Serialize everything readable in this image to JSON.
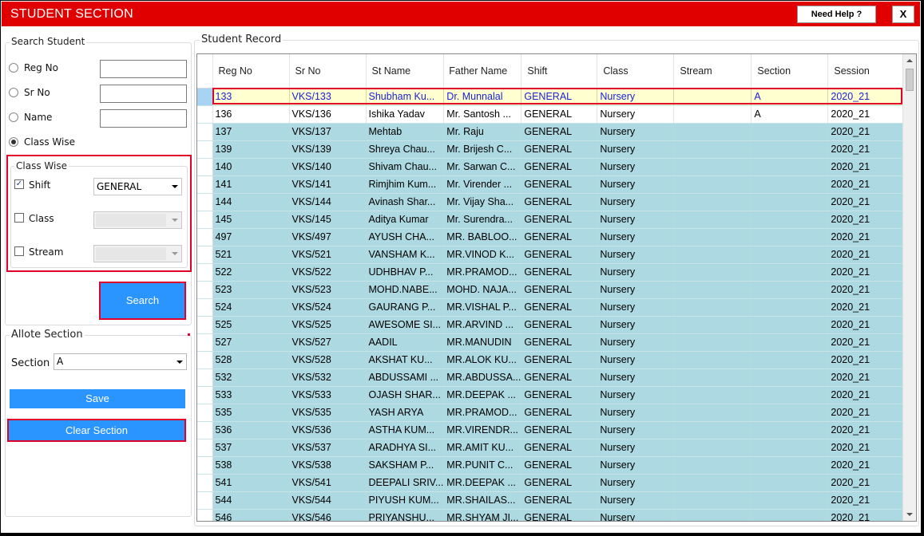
{
  "window": {
    "title": "STUDENT SECTION",
    "help_label": "Need Help ?",
    "close_label": "X"
  },
  "search": {
    "group_title": "Search Student",
    "options": [
      {
        "label": "Reg No",
        "checked": false,
        "value": ""
      },
      {
        "label": "Sr No",
        "checked": false,
        "value": ""
      },
      {
        "label": "Name",
        "checked": false,
        "value": ""
      },
      {
        "label": "Class Wise",
        "checked": true
      }
    ],
    "class_wise": {
      "title": "Class Wise",
      "shift": {
        "label": "Shift",
        "checked": true,
        "value": "GENERAL"
      },
      "class": {
        "label": "Class",
        "checked": false,
        "value": ""
      },
      "stream": {
        "label": "Stream",
        "checked": false,
        "value": ""
      }
    },
    "search_button": "Search"
  },
  "allot": {
    "group_title": "Allote Section",
    "section_label": "Section",
    "section_value": "A",
    "save_button": "Save",
    "clear_button": "Clear Section"
  },
  "record": {
    "group_title": "Student Record",
    "columns": [
      "Reg No",
      "Sr No",
      "St Name",
      "Father Name",
      "Shift",
      "Class",
      "Stream",
      "Section",
      "Session"
    ],
    "rows": [
      [
        "133",
        "VKS/133",
        "Shubham Ku...",
        "Dr. Munnalal",
        "GENERAL",
        "Nursery",
        "",
        "A",
        "2020_21"
      ],
      [
        "136",
        "VKS/136",
        "Ishika Yadav",
        "Mr. Santosh ...",
        "GENERAL",
        "Nursery",
        "",
        "A",
        "2020_21"
      ],
      [
        "137",
        "VKS/137",
        "Mehtab",
        "Mr. Raju",
        "GENERAL",
        "Nursery",
        "",
        "",
        "2020_21"
      ],
      [
        "139",
        "VKS/139",
        "Shreya Chau...",
        "Mr. Brijesh C...",
        "GENERAL",
        "Nursery",
        "",
        "",
        "2020_21"
      ],
      [
        "140",
        "VKS/140",
        "Shivam Chau...",
        "Mr. Sarwan C...",
        "GENERAL",
        "Nursery",
        "",
        "",
        "2020_21"
      ],
      [
        "141",
        "VKS/141",
        "Rimjhim Kum...",
        "Mr. Virender ...",
        "GENERAL",
        "Nursery",
        "",
        "",
        "2020_21"
      ],
      [
        "144",
        "VKS/144",
        "Avinash Shar...",
        "Mr. Vijay Sha...",
        "GENERAL",
        "Nursery",
        "",
        "",
        "2020_21"
      ],
      [
        "145",
        "VKS/145",
        "Aditya Kumar",
        "Mr. Surendra...",
        "GENERAL",
        "Nursery",
        "",
        "",
        "2020_21"
      ],
      [
        "497",
        "VKS/497",
        "AYUSH CHA...",
        "MR. BABLOO...",
        "GENERAL",
        "Nursery",
        "",
        "",
        "2020_21"
      ],
      [
        "521",
        "VKS/521",
        "VANSHAM K...",
        "MR.VINOD K...",
        "GENERAL",
        "Nursery",
        "",
        "",
        "2020_21"
      ],
      [
        "522",
        "VKS/522",
        "UDHBHAV P...",
        "MR.PRAMOD...",
        "GENERAL",
        "Nursery",
        "",
        "",
        "2020_21"
      ],
      [
        "523",
        "VKS/523",
        "MOHD.NABE...",
        "MOHD. NAJA...",
        "GENERAL",
        "Nursery",
        "",
        "",
        "2020_21"
      ],
      [
        "524",
        "VKS/524",
        "GAURANG P...",
        "MR.VISHAL P...",
        "GENERAL",
        "Nursery",
        "",
        "",
        "2020_21"
      ],
      [
        "525",
        "VKS/525",
        "AWESOME SI...",
        "MR.ARVIND ...",
        "GENERAL",
        "Nursery",
        "",
        "",
        "2020_21"
      ],
      [
        "527",
        "VKS/527",
        "AADIL",
        "MR.MANUDIN",
        "GENERAL",
        "Nursery",
        "",
        "",
        "2020_21"
      ],
      [
        "528",
        "VKS/528",
        "AKSHAT KU...",
        "MR.ALOK KU...",
        "GENERAL",
        "Nursery",
        "",
        "",
        "2020_21"
      ],
      [
        "532",
        "VKS/532",
        "ABDUSSAMI ...",
        "MR.ABDUSSA...",
        "GENERAL",
        "Nursery",
        "",
        "",
        "2020_21"
      ],
      [
        "533",
        "VKS/533",
        "OJASH SHAR...",
        "MR.DEEPAK ...",
        "GENERAL",
        "Nursery",
        "",
        "",
        "2020_21"
      ],
      [
        "535",
        "VKS/535",
        "YASH ARYA",
        "MR.PRAMOD...",
        "GENERAL",
        "Nursery",
        "",
        "",
        "2020_21"
      ],
      [
        "536",
        "VKS/536",
        "ASTHA KUM...",
        "MR.VIRENDR...",
        "GENERAL",
        "Nursery",
        "",
        "",
        "2020_21"
      ],
      [
        "537",
        "VKS/537",
        "ARADHYA SI...",
        "MR.AMIT KU...",
        "GENERAL",
        "Nursery",
        "",
        "",
        "2020_21"
      ],
      [
        "538",
        "VKS/538",
        "SAKSHAM P...",
        "MR.PUNIT C...",
        "GENERAL",
        "Nursery",
        "",
        "",
        "2020_21"
      ],
      [
        "541",
        "VKS/541",
        "DEEPALI SRIV...",
        "MR.DEEPAK ...",
        "GENERAL",
        "Nursery",
        "",
        "",
        "2020_21"
      ],
      [
        "544",
        "VKS/544",
        "PIYUSH KUM...",
        "MR.SHAILAS...",
        "GENERAL",
        "Nursery",
        "",
        "",
        "2020_21"
      ],
      [
        "546",
        "VKS/546",
        "PRIYANSHU...",
        "MR.SHYAM JI...",
        "GENERAL",
        "Nursery",
        "",
        "",
        "2020_21"
      ]
    ]
  },
  "colors": {
    "titlebar": "#e00000",
    "button": "#2a95ff",
    "row_teal": "#add9e2",
    "row_selected": "#ffffd0",
    "highlight_border": "#e0002a"
  }
}
